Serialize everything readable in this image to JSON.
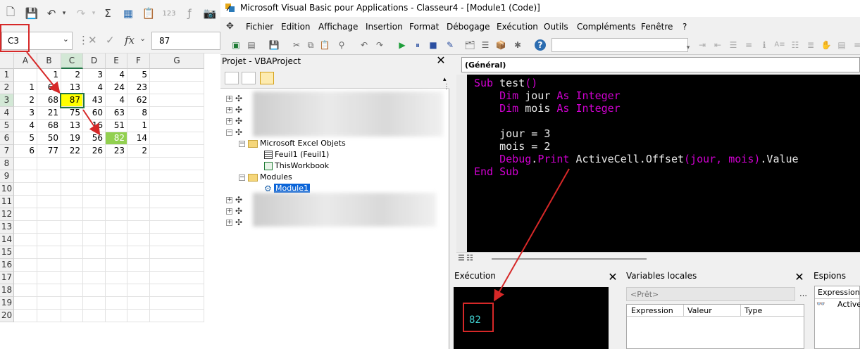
{
  "excel": {
    "name_box": "C3",
    "formula_value": "87",
    "fx_label": "fx",
    "columns": [
      "A",
      "B",
      "C",
      "D",
      "E",
      "F",
      "G"
    ],
    "rows": [
      "1",
      "2",
      "3",
      "4",
      "5",
      "6",
      "7",
      "8",
      "9",
      "10",
      "11",
      "12",
      "13",
      "14",
      "15",
      "16",
      "17",
      "18",
      "19",
      "20"
    ],
    "cells": [
      [
        "",
        "1",
        "2",
        "3",
        "4",
        "5"
      ],
      [
        "1",
        "68",
        "13",
        "4",
        "24",
        "23"
      ],
      [
        "2",
        "68",
        "87",
        "43",
        "4",
        "62"
      ],
      [
        "3",
        "21",
        "75",
        "60",
        "63",
        "8"
      ],
      [
        "4",
        "68",
        "13",
        "16",
        "51",
        "1"
      ],
      [
        "5",
        "50",
        "19",
        "56",
        "82",
        "14"
      ],
      [
        "6",
        "77",
        "22",
        "26",
        "23",
        "2"
      ]
    ],
    "highlight_yellow": "#ffff00",
    "highlight_green": "#92d050"
  },
  "vba": {
    "title": "Microsoft Visual Basic pour Applications - Classeur4 - [Module1 (Code)]",
    "menus": [
      "Fichier",
      "Edition",
      "Affichage",
      "Insertion",
      "Format",
      "Débogage",
      "Exécution",
      "Outils",
      "Compléments",
      "Fenêtre",
      "?"
    ],
    "project": {
      "title": "Projet - VBAProject",
      "microsoft_objects": "Microsoft Excel Objets",
      "sheet1": "Feuil1 (Feuil1)",
      "workbook": "ThisWorkbook",
      "modules": "Modules",
      "module1": "Module1"
    },
    "code_combo": "(Général)",
    "code": {
      "line1_kw": "Sub",
      "line1_rest": " test",
      "line1_paren": "()",
      "line2_kw": "Dim",
      "line2_var": " jour ",
      "line2_as": "As",
      "line2_type": " Integer",
      "line3_kw": "Dim",
      "line3_var": " mois ",
      "line3_as": "As",
      "line3_type": " Integer",
      "line5": "jour = 3",
      "line6": "mois = 2",
      "line7_kw1": "Debug",
      "line7_dot": ".",
      "line7_kw2": "Print",
      "line7_rest": " ActiveCell.Offset",
      "line7_paren": "(jour, mois)",
      "line7_end": ".Value",
      "line8_kw": "End Sub"
    },
    "execution": {
      "title": "Exécution",
      "output": "82"
    },
    "locals": {
      "title": "Variables locales",
      "status": "<Prêt>",
      "columns": [
        "Expression",
        "Valeur",
        "Type"
      ]
    },
    "spies": {
      "title": "Espions",
      "column": "Expression",
      "item": "Active"
    }
  },
  "colors": {
    "keyword": "#d100d1",
    "arrow": "#d62828",
    "immediate_text": "#40d0d0"
  }
}
